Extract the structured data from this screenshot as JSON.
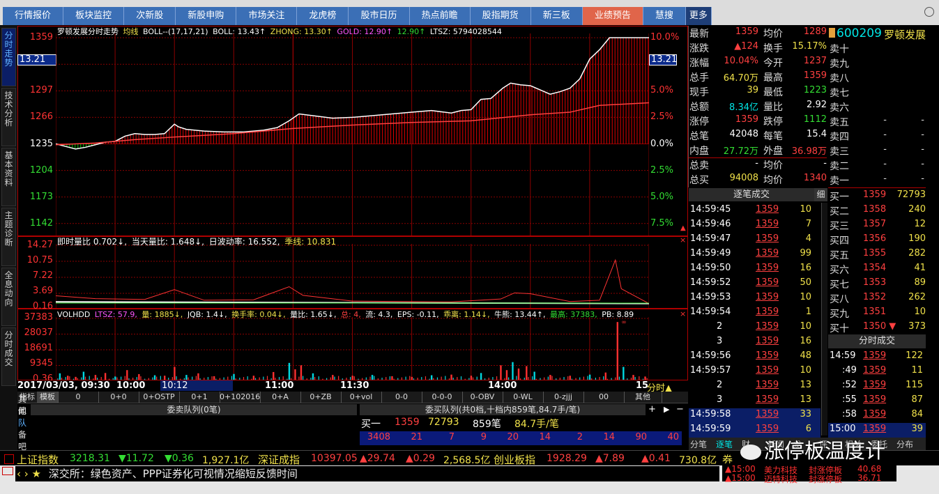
{
  "nav": {
    "tabs": [
      "行情报价",
      "板块监控",
      "次新股",
      "新股申购",
      "市场关注",
      "龙虎榜",
      "股市日历",
      "热点前瞻",
      "股指期货",
      "新三板",
      "业绩预告",
      "慧搜"
    ],
    "active_index": 10,
    "more": "更多"
  },
  "side_tabs": [
    "分时走势",
    "技术分析",
    "基本资料",
    "主题诊断",
    "全息动向",
    "分时成交"
  ],
  "side_active_index": 0,
  "main_chart": {
    "header": {
      "name": "罗顿发展分时走势",
      "avg_label": "均线",
      "boll_label": "BOLL--(17,17,21)",
      "boll": "BOLL: 13.43↑",
      "zhong": "ZHONG: 13.30↑",
      "gold": "GOLD: 12.90↑",
      "gold2": "12.90↑",
      "ltsz": "LTSZ: 5794028544"
    },
    "price_labels": [
      "1359",
      "1297",
      "1266",
      "1235",
      "1204",
      "1173",
      "1142"
    ],
    "pct_labels": [
      "10.0%",
      "5.0%",
      "2.5%",
      "0.0%",
      "2.5%",
      "5.0%",
      "7.5%"
    ],
    "cursor_price": "13.21",
    "price_min": 1128,
    "price_max": 1364,
    "prev_close": 1235,
    "price_path": [
      [
        0,
        1235
      ],
      [
        5,
        1232
      ],
      [
        10,
        1229
      ],
      [
        15,
        1231
      ],
      [
        20,
        1234
      ],
      [
        25,
        1237
      ],
      [
        30,
        1238
      ],
      [
        35,
        1244
      ],
      [
        40,
        1247
      ],
      [
        45,
        1246
      ],
      [
        50,
        1246
      ],
      [
        55,
        1247
      ],
      [
        60,
        1258
      ],
      [
        62,
        1255
      ],
      [
        66,
        1252
      ],
      [
        75,
        1250
      ],
      [
        85,
        1249
      ],
      [
        95,
        1249
      ],
      [
        105,
        1251
      ],
      [
        112,
        1254
      ],
      [
        118,
        1262
      ],
      [
        123,
        1270
      ],
      [
        130,
        1268
      ],
      [
        140,
        1265
      ],
      [
        150,
        1266
      ],
      [
        160,
        1268
      ],
      [
        170,
        1270
      ],
      [
        180,
        1272
      ],
      [
        190,
        1274
      ],
      [
        200,
        1271
      ],
      [
        205,
        1274
      ],
      [
        210,
        1275
      ],
      [
        215,
        1287
      ],
      [
        220,
        1288
      ],
      [
        226,
        1300
      ],
      [
        230,
        1306
      ],
      [
        235,
        1304
      ],
      [
        240,
        1303
      ],
      [
        244,
        1299
      ],
      [
        250,
        1293
      ],
      [
        255,
        1296
      ],
      [
        260,
        1300
      ],
      [
        265,
        1311
      ],
      [
        270,
        1334
      ],
      [
        275,
        1345
      ],
      [
        280,
        1359
      ],
      [
        290,
        1359
      ],
      [
        300,
        1359
      ]
    ],
    "avg_path": [
      [
        0,
        1234
      ],
      [
        20,
        1236
      ],
      [
        40,
        1240
      ],
      [
        60,
        1243
      ],
      [
        90,
        1247
      ],
      [
        120,
        1253
      ],
      [
        150,
        1257
      ],
      [
        180,
        1260
      ],
      [
        210,
        1262
      ],
      [
        240,
        1269
      ],
      [
        260,
        1272
      ],
      [
        275,
        1280
      ],
      [
        300,
        1283
      ]
    ],
    "time_labels": [
      "2017/03/03, 09:30",
      "10:00",
      "10:12",
      "11:00",
      "11:30",
      "14:00",
      "15"
    ],
    "time_suffix": "分时▲"
  },
  "vr_chart": {
    "header": {
      "a": "即时量比 0.702↓,",
      "b": "当天量比: 1.648↓,",
      "c": "日波动率: 16.552,",
      "d": "季线: 10.831"
    },
    "labels": [
      "14.27",
      "10.75",
      "7.22",
      "3.69",
      "0.16"
    ],
    "max": 14.27,
    "spikes": [
      [
        0,
        2.3
      ],
      [
        20,
        1.6
      ],
      [
        45,
        1.4
      ],
      [
        60,
        3.8
      ],
      [
        75,
        1.2
      ],
      [
        100,
        1.3
      ],
      [
        118,
        4.5
      ],
      [
        125,
        2.4
      ],
      [
        150,
        1.0
      ],
      [
        175,
        0.9
      ],
      [
        200,
        0.8
      ],
      [
        225,
        1.5
      ],
      [
        232,
        3.0
      ],
      [
        240,
        2.8
      ],
      [
        260,
        0.9
      ],
      [
        275,
        1.2
      ],
      [
        283,
        11.0
      ],
      [
        286,
        4.0
      ],
      [
        300,
        0.4
      ]
    ]
  },
  "vol_chart": {
    "header": {
      "a": "VOLHDD",
      "b": "LTSZ: 57.9,",
      "c": "量: 1885↓,",
      "d": "JQB: 1.4↓,",
      "e": "换手率: 0.04↓,",
      "f": "量比: 1.65↓,",
      "g": "总: 4,",
      "h": "流: 4.3,",
      "i": "EPS: -0.11,",
      "j": "乖离: 1.14↓,",
      "k": "牛熊: 13.44↑,",
      "l": "最高: 37383,",
      "m": "PB: 8.89"
    },
    "labels": [
      "37383",
      "28037",
      "18691",
      "9345",
      "0.36"
    ],
    "max": 37383,
    "peak_mark": "∞",
    "bars": [
      [
        2,
        4000
      ],
      [
        6,
        2500
      ],
      [
        10,
        1800
      ],
      [
        14,
        5000
      ],
      [
        20,
        3000
      ],
      [
        25,
        4200
      ],
      [
        30,
        2000
      ],
      [
        36,
        6000
      ],
      [
        42,
        3500
      ],
      [
        50,
        2800
      ],
      [
        55,
        2500
      ],
      [
        60,
        8000
      ],
      [
        66,
        3000
      ],
      [
        72,
        4000
      ],
      [
        80,
        2200
      ],
      [
        90,
        3600
      ],
      [
        100,
        2500
      ],
      [
        110,
        4800
      ],
      [
        118,
        10500
      ],
      [
        121,
        6500
      ],
      [
        124,
        9000
      ],
      [
        130,
        4000
      ],
      [
        140,
        3000
      ],
      [
        150,
        2500
      ],
      [
        160,
        3000
      ],
      [
        170,
        2200
      ],
      [
        180,
        1800
      ],
      [
        190,
        2800
      ],
      [
        200,
        3200
      ],
      [
        210,
        2500
      ],
      [
        215,
        4200
      ],
      [
        225,
        9000
      ],
      [
        228,
        6000
      ],
      [
        231,
        11000
      ],
      [
        234,
        7000
      ],
      [
        238,
        8500
      ],
      [
        242,
        5000
      ],
      [
        250,
        3000
      ],
      [
        260,
        2500
      ],
      [
        270,
        3200
      ],
      [
        278,
        4500
      ],
      [
        284,
        36000
      ],
      [
        287,
        8000
      ],
      [
        292,
        3000
      ],
      [
        298,
        2000
      ]
    ]
  },
  "indicator_tabs": [
    "指标",
    "模板",
    "0",
    "0+0",
    "0+OSTP",
    "0+1",
    "0+102016",
    "0+A",
    "0+ZB",
    "0+vol",
    "0-0",
    "0-0-0",
    "0-OBV",
    "0-WL",
    "0-zjjj",
    "00",
    "其他"
  ],
  "queues": {
    "left_title": "委卖队列(0笔)",
    "right_title": "委买队列(共0档,十档内859笔,84.7手/笔)",
    "buy1_label": "买一",
    "buy1_price": "1359",
    "buy1_vol": "72793",
    "buy1_count": "859笔",
    "buy1_avg": "84.7手/笔",
    "queue": [
      "3408",
      "21",
      "7",
      "9",
      "20",
      "14",
      "2",
      "14",
      "90",
      "40"
    ],
    "left_side": [
      "其他",
      "闻",
      "队",
      "备",
      "吧"
    ]
  },
  "quote": {
    "rows": [
      {
        "l1": "最新",
        "v1": "1359",
        "c1": "red",
        "l2": "均价",
        "v2": "1289",
        "c2": "red"
      },
      {
        "l1": "涨跌",
        "v1": "▲124",
        "c1": "red",
        "l2": "换手",
        "v2": "15.17%",
        "c2": "yel"
      },
      {
        "l1": "涨幅",
        "v1": "10.04%",
        "c1": "red",
        "l2": "今开",
        "v2": "1237",
        "c2": "red"
      },
      {
        "l1": "总手",
        "v1": "64.70万",
        "c1": "yel",
        "l2": "最高",
        "v2": "1359",
        "c2": "red"
      },
      {
        "l1": "现手",
        "v1": "39",
        "c1": "yel",
        "l2": "最低",
        "v2": "1223",
        "c2": "grn"
      },
      {
        "l1": "总额",
        "v1": "8.34亿",
        "c1": "cyan",
        "l2": "量比",
        "v2": "2.92",
        "c2": "wht"
      },
      {
        "l1": "涨停",
        "v1": "1359",
        "c1": "red",
        "l2": "跌停",
        "v2": "1112",
        "c2": "grn"
      },
      {
        "l1": "总笔",
        "v1": "42048",
        "c1": "wht",
        "l2": "每笔",
        "v2": "15.4",
        "c2": "wht"
      },
      {
        "l1": "内盘",
        "v1": "27.72万",
        "c1": "grn",
        "l2": "外盘",
        "v2": "36.98万",
        "c2": "red"
      },
      {
        "l1": "总卖",
        "v1": "-",
        "c1": "wht",
        "l2": "均价",
        "v2": "-",
        "c2": "wht"
      },
      {
        "l1": "总买",
        "v1": "94008",
        "c1": "yel",
        "l2": "均价",
        "v2": "1340",
        "c2": "red"
      }
    ]
  },
  "stock": {
    "code": "600209",
    "name": "罗顿发展"
  },
  "sell_rows": [
    {
      "l": "卖十",
      "p": "",
      "v": ""
    },
    {
      "l": "卖九",
      "p": "",
      "v": ""
    },
    {
      "l": "卖八",
      "p": "",
      "v": ""
    },
    {
      "l": "卖七",
      "p": "",
      "v": ""
    },
    {
      "l": "卖六",
      "p": "",
      "v": ""
    },
    {
      "l": "卖五",
      "p": "-",
      "v": "-"
    },
    {
      "l": "卖四",
      "p": "-",
      "v": "-"
    },
    {
      "l": "卖三",
      "p": "-",
      "v": "-"
    },
    {
      "l": "卖二",
      "p": "-",
      "v": "-"
    },
    {
      "l": "卖一",
      "p": "-",
      "v": "-"
    }
  ],
  "buy_rows": [
    {
      "l": "买一",
      "p": "1359",
      "v": "72793"
    },
    {
      "l": "买二",
      "p": "1358",
      "v": "240"
    },
    {
      "l": "买三",
      "p": "1357",
      "v": "12"
    },
    {
      "l": "买四",
      "p": "1356",
      "v": "190"
    },
    {
      "l": "买五",
      "p": "1355",
      "v": "282"
    },
    {
      "l": "买六",
      "p": "1354",
      "v": "41"
    },
    {
      "l": "买七",
      "p": "1353",
      "v": "89"
    },
    {
      "l": "买八",
      "p": "1352",
      "v": "262"
    },
    {
      "l": "买九",
      "p": "1351",
      "v": "10"
    },
    {
      "l": "买十",
      "p": "1350 ▼",
      "v": "373"
    }
  ],
  "ticks_title": "逐笔成交",
  "ticks_side": "细",
  "ticks": [
    {
      "t": "14:59:45",
      "p": "1359",
      "v": "10"
    },
    {
      "t": "14:59:46",
      "p": "1359",
      "v": "7"
    },
    {
      "t": "14:59:47",
      "p": "1359",
      "v": "4"
    },
    {
      "t": "14:59:49",
      "p": "1359",
      "v": "99"
    },
    {
      "t": "14:59:50",
      "p": "1359",
      "v": "16"
    },
    {
      "t": "14:59:52",
      "p": "1359",
      "v": "50"
    },
    {
      "t": "14:59:53",
      "p": "1359",
      "v": "10"
    },
    {
      "t": "14:59:54",
      "p": "1359",
      "v": "1"
    },
    {
      "t": "2",
      "p": "1359",
      "v": "10"
    },
    {
      "t": "3",
      "p": "1359",
      "v": "16"
    },
    {
      "t": "14:59:56",
      "p": "1359",
      "v": "48"
    },
    {
      "t": "14:59:57",
      "p": "1359",
      "v": "10"
    },
    {
      "t": "2",
      "p": "1359",
      "v": "13"
    },
    {
      "t": "3",
      "p": "1359",
      "v": "13"
    },
    {
      "t": "14:59:58",
      "p": "1359",
      "v": "33"
    },
    {
      "t": "14:59:59",
      "p": "1359",
      "v": "6"
    }
  ],
  "min_title": "分时成交",
  "min_ticks": [
    {
      "t": "14:59",
      "p": "1359",
      "v": "122"
    },
    {
      "t": ":49",
      "p": "1359",
      "v": "11"
    },
    {
      "t": ":52",
      "p": "1359",
      "v": "115"
    },
    {
      "t": ":55",
      "p": "1359",
      "v": "87"
    },
    {
      "t": ":58",
      "p": "1359",
      "v": "84"
    },
    {
      "t": "15:00",
      "p": "1359",
      "v": "39"
    }
  ],
  "right_bottom_tabs": [
    "分笔",
    "逐笔",
    "财",
    "新闻",
    "龙",
    "评",
    "相关",
    "委托",
    "分布"
  ],
  "index_bar": [
    {
      "name": "上证指数",
      "val": "3218.31",
      "chg": "▼11.72",
      "pct": "▼0.36",
      "amt": "1,927.1亿"
    },
    {
      "name": "深证成指",
      "val": "10397.05",
      "chg": "▲29.74",
      "pct": "▲0.29",
      "amt": "2,568.5亿"
    },
    {
      "name": "创业板指",
      "val": "1928.29",
      "chg": "▲7.89",
      "pct": "▲0.41",
      "amt": "730.8亿"
    }
  ],
  "index_tail": "券",
  "news": "深交所：绿色资产、PPP证券化可视情况缩短反馈时间",
  "alerts": [
    {
      "t": "▲15:00",
      "name": "美力科技",
      "msg": "封涨停板",
      "v": "40.68"
    },
    {
      "t": "▲15:00",
      "name": "迈特科技",
      "msg": "封涨停板",
      "v": "36.71"
    }
  ],
  "watermark": "涨停板温度计",
  "colors": {
    "up": "#ff3333",
    "down": "#33dd33",
    "frame": "#b00000",
    "nav": "#3b6fb6",
    "nav_active": "#e0654a"
  }
}
